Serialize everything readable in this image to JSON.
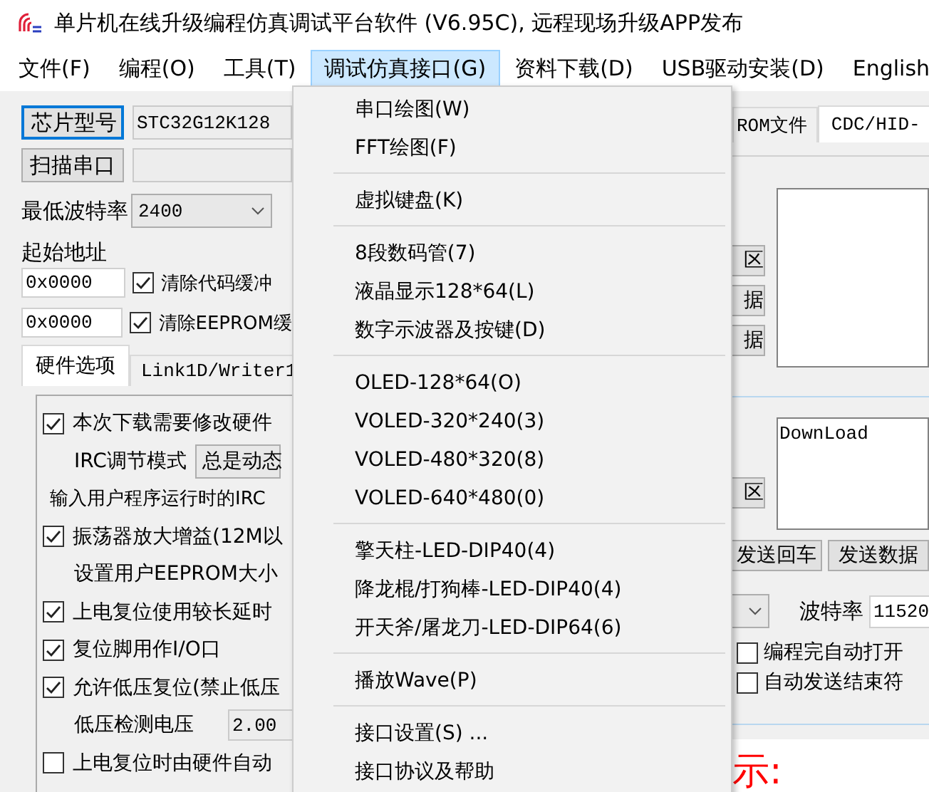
{
  "window": {
    "title": "单片机在线升级编程仿真调试平台软件 (V6.95C), 远程现场升级APP发布"
  },
  "menu_bar": [
    {
      "label": "文件(F)",
      "selected": false
    },
    {
      "label": "编程(O)",
      "selected": false
    },
    {
      "label": "工具(T)",
      "selected": false
    },
    {
      "label": "调试仿真接口(G)",
      "selected": true
    },
    {
      "label": "资料下载(D)",
      "selected": false
    },
    {
      "label": "USB驱动安装(D)",
      "selected": false
    },
    {
      "label": "English",
      "selected": false
    }
  ],
  "chip": {
    "button": "芯片型号",
    "value": "STC32G12K128"
  },
  "scan": {
    "button": "扫描串口"
  },
  "min_baud": {
    "label": "最低波特率",
    "value": "2400"
  },
  "start_address": {
    "label": "起始地址",
    "rows": [
      {
        "value": "0x0000",
        "checkbox": "清除代码缓冲",
        "checked": true
      },
      {
        "value": "0x0000",
        "checkbox": "清除EEPROM缓",
        "checked": true
      }
    ]
  },
  "left_tabs": [
    {
      "label": "硬件选项",
      "selected": true
    },
    {
      "label": "Link1D/Writer1",
      "selected": false
    }
  ],
  "hardware_options": [
    {
      "kind": "checkbox",
      "label": "本次下载需要修改硬件",
      "checked": true
    },
    {
      "kind": "combo",
      "label": "IRC调节模式",
      "value": "总是动态"
    },
    {
      "kind": "text",
      "label": "输入用户程序运行时的IRC"
    },
    {
      "kind": "checkbox",
      "label": "振荡器放大增益(12M以",
      "checked": true
    },
    {
      "kind": "label",
      "label": "设置用户EEPROM大小"
    },
    {
      "kind": "checkbox",
      "label": "上电复位使用较长延时",
      "checked": true
    },
    {
      "kind": "checkbox",
      "label": "复位脚用作I/O口",
      "checked": true
    },
    {
      "kind": "checkbox",
      "label": "允许低压复位(禁止低压",
      "checked": true
    },
    {
      "kind": "field",
      "label": "低压检测电压",
      "value": "2.00"
    },
    {
      "kind": "checkbox",
      "label": "上电复位时由硬件自动",
      "checked": false
    }
  ],
  "dropdown": {
    "groups": [
      [
        "串口绘图(W)",
        "FFT绘图(F)"
      ],
      [
        "虚拟键盘(K)"
      ],
      [
        "8段数码管(7)",
        "液晶显示128*64(L)",
        "数字示波器及按键(D)"
      ],
      [
        "OLED-128*64(O)",
        "VOLED-320*240(3)",
        "VOLED-480*320(8)",
        "VOLED-640*480(0)"
      ],
      [
        "擎天柱-LED-DIP40(4)",
        "降龙棍/打狗棒-LED-DIP40(4)",
        "开天斧/屠龙刀-LED-DIP64(6)"
      ],
      [
        "播放Wave(P)"
      ],
      [
        "接口设置(S) ...",
        "接口协议及帮助"
      ]
    ]
  },
  "right_tabs": [
    {
      "label": "ROM文件",
      "selected": false
    },
    {
      "label": "CDC/HID-",
      "selected": true
    }
  ],
  "receive": {
    "buttons": [
      "区",
      "据",
      "据"
    ]
  },
  "send": {
    "text": "DownLoad",
    "buttons": [
      "区"
    ]
  },
  "send_buttons": [
    "发送回车",
    "发送数据"
  ],
  "baud": {
    "label": "波特率",
    "value": "11520"
  },
  "options": [
    {
      "label": "编程完自动打开",
      "checked": false
    },
    {
      "label": "自动发送结束符",
      "checked": false
    }
  ],
  "notice": "示:"
}
